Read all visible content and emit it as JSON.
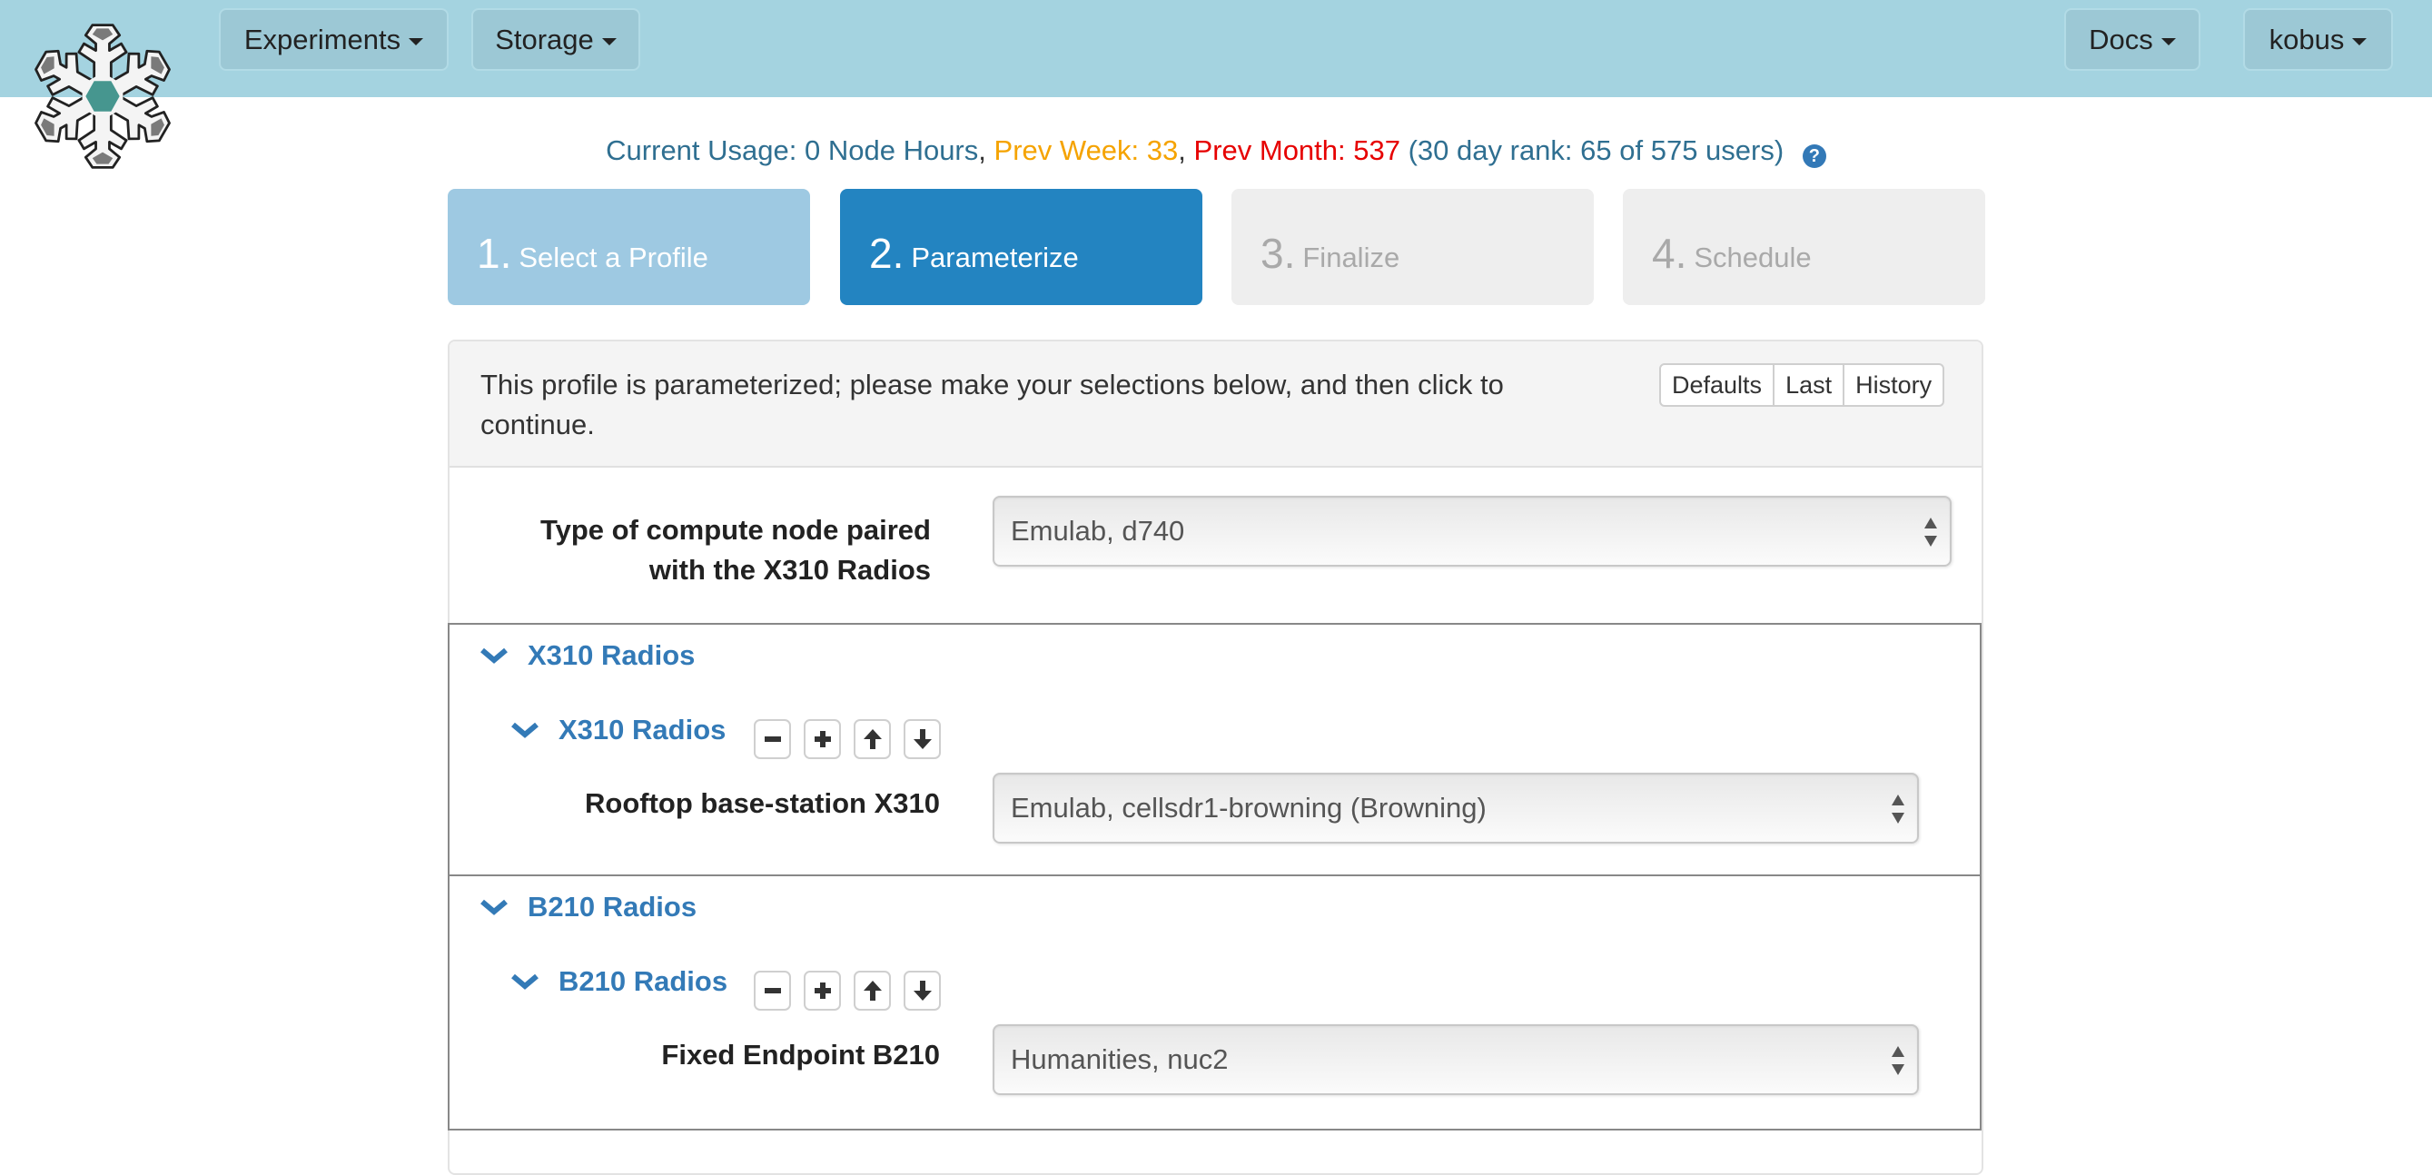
{
  "navbar": {
    "logo": "snowflake-logo",
    "left_menus": [
      {
        "label": "Experiments"
      },
      {
        "label": "Storage"
      }
    ],
    "right_menus": [
      {
        "label": "Docs"
      },
      {
        "label": "kobus"
      }
    ]
  },
  "usage": {
    "current": "Current Usage: 0 Node Hours",
    "comma": ",",
    "prev_week": "Prev Week: 33",
    "prev_month": "Prev Month: 537",
    "rank": "(30 day rank: 65 of 575 users)",
    "help_icon": "?",
    "colors": {
      "current": "#2f6f91",
      "prev_week": "#f5a300",
      "prev_month": "#e60000"
    }
  },
  "steps": [
    {
      "num": "1.",
      "label": "Select a Profile",
      "state": "done"
    },
    {
      "num": "2.",
      "label": "Parameterize",
      "state": "active"
    },
    {
      "num": "3.",
      "label": "Finalize",
      "state": "todo"
    },
    {
      "num": "4.",
      "label": "Schedule",
      "state": "todo"
    }
  ],
  "panel": {
    "message": "This profile is parameterized; please make your selections below, and then click to continue.",
    "buttons": [
      "Defaults",
      "Last",
      "History"
    ],
    "compute_node": {
      "label_line1": "Type of compute node paired",
      "label_line2": "with the X310 Radios",
      "value": "Emulab, d740"
    },
    "sections": [
      {
        "title": "X310 Radios",
        "sub_title": "X310 Radios",
        "field_label": "Rooftop base-station X310",
        "value": "Emulab, cellsdr1-browning (Browning)"
      },
      {
        "title": "B210 Radios",
        "sub_title": "B210 Radios",
        "field_label": "Fixed Endpoint B210",
        "value": "Humanities, nuc2"
      }
    ]
  }
}
